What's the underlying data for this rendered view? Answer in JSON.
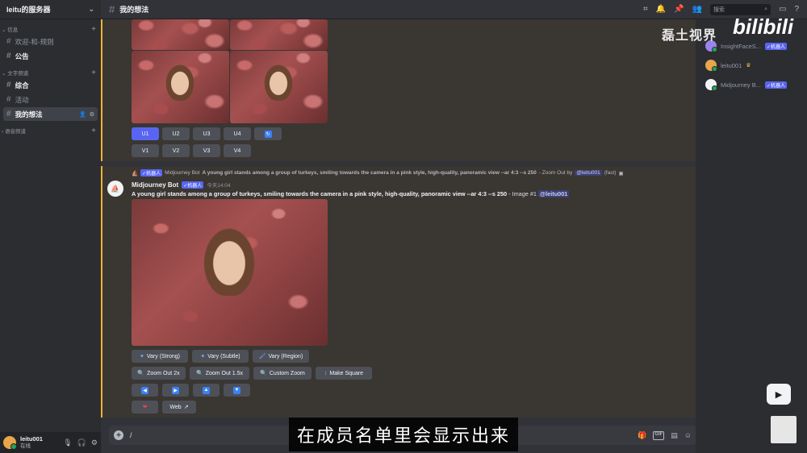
{
  "server": {
    "name": "leitu的服务器"
  },
  "sidebar": {
    "categories": [
      {
        "label": "信息",
        "channels": [
          "欢迎-和-规则",
          "公告"
        ]
      },
      {
        "label": "文字频道",
        "channels": [
          "综合",
          "活动",
          "我的想法"
        ]
      },
      {
        "label": "语音频道"
      }
    ]
  },
  "user": {
    "name": "leitu001",
    "status": "在线"
  },
  "topbar": {
    "channel": "我的想法",
    "search_placeholder": "搜索"
  },
  "buttons_top": {
    "u": [
      "U1",
      "U2",
      "U3",
      "U4"
    ],
    "v": [
      "V1",
      "V2",
      "V3",
      "V4"
    ]
  },
  "message": {
    "reply_tag": "✓机器人",
    "reply_author": "Midjourney Bot",
    "reply_prompt": "A young girl stands among a group of turkeys, smiling towards the camera in a pink style, high-quality, panoramic view --ar 4:3 --s 250",
    "reply_suffix": "- Zoom Out by",
    "reply_mention": "@leitu001",
    "reply_speed": "(fast)",
    "author": "Midjourney Bot",
    "author_tag": "✓机器人",
    "time": "今天14:04",
    "prompt": "A young girl stands among a group of turkeys, smiling towards the camera in a pink style, high-quality, panoramic view --ar 4:3 --s 250",
    "suffix": "- Image #1",
    "mention": "@leitu001"
  },
  "actions": {
    "vary_strong": "Vary (Strong)",
    "vary_subtle": "Vary (Subtle)",
    "vary_region": "Vary (Region)",
    "zoom_2x": "Zoom Out 2x",
    "zoom_15x": "Zoom Out 1.5x",
    "custom_zoom": "Custom Zoom",
    "make_square": "Make Square",
    "web": "Web"
  },
  "composer": {
    "value": "/"
  },
  "members": [
    {
      "name": "InsightFaceS...",
      "tag": "✓机器人",
      "color": "#9b84ec"
    },
    {
      "name": "leitu001",
      "tag": "",
      "color": "#e8a54b"
    },
    {
      "name": "Midjourney B...",
      "tag": "✓机器人",
      "color": "#f2f3f5"
    }
  ],
  "overlay": {
    "watermark": "磊土视界",
    "bilibili": "bilibili",
    "subtitle": "在成员名单里会显示出来"
  },
  "colors": {
    "accent": "#5865f2",
    "highlight": "#f0b232",
    "online": "#23a55a"
  }
}
